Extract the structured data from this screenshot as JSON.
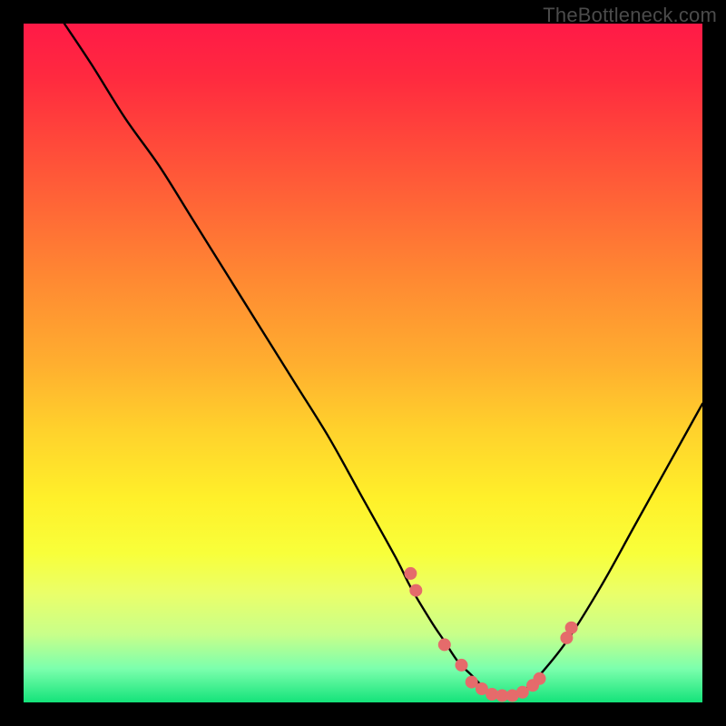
{
  "watermark": "TheBottleneck.com",
  "colors": {
    "frame": "#000000",
    "curve": "#000000",
    "dot_fill": "#e56b6b",
    "dot_stroke": "#c94f4f"
  },
  "chart_data": {
    "type": "line",
    "title": "",
    "xlabel": "",
    "ylabel": "",
    "xlim": [
      0,
      100
    ],
    "ylim": [
      0,
      100
    ],
    "series": [
      {
        "name": "bottleneck-curve",
        "x": [
          6,
          10,
          15,
          20,
          25,
          30,
          35,
          40,
          45,
          50,
          55,
          57,
          60,
          62,
          64,
          66,
          68,
          70,
          72,
          74,
          76,
          80,
          85,
          90,
          95,
          100
        ],
        "y": [
          100,
          94,
          86,
          79,
          71,
          63,
          55,
          47,
          39,
          30,
          21,
          17,
          12,
          9,
          6,
          4,
          2,
          1,
          1,
          2,
          4,
          9,
          17,
          26,
          35,
          44
        ]
      }
    ],
    "dots": {
      "name": "highlight-dots",
      "x": [
        57,
        57.8,
        62,
        64.5,
        66,
        67.5,
        69,
        70.5,
        72,
        73.5,
        75,
        76,
        80,
        80.7
      ],
      "y": [
        19,
        16.5,
        8.5,
        5.5,
        3,
        2,
        1.2,
        1,
        1,
        1.5,
        2.5,
        3.5,
        9.5,
        11
      ]
    }
  }
}
